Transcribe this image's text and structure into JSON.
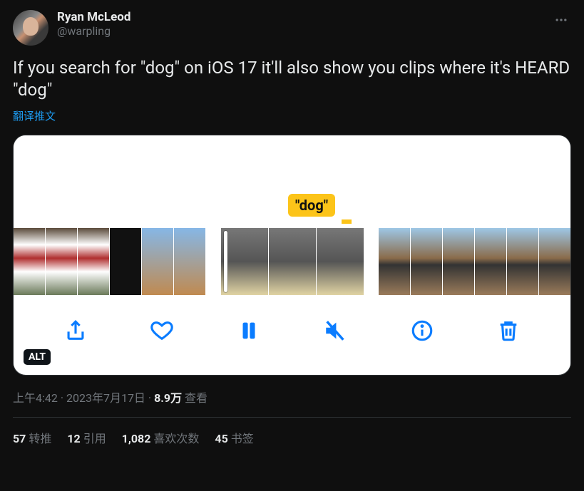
{
  "author": {
    "display_name": "Ryan McLeod",
    "handle": "@warpling"
  },
  "body_text": "If you search for \"dog\" on iOS 17 it'll also show you clips where it's HEARD \"dog\"",
  "translate_label": "翻译推文",
  "media": {
    "search_label": "\"dog\"",
    "alt_badge": "ALT"
  },
  "meta": {
    "time": "上午4:42",
    "sep1": " · ",
    "date": "2023年7月17日",
    "sep2": " · ",
    "views_count": "8.9万",
    "views_label": " 查看"
  },
  "stats": {
    "retweets_count": "57",
    "retweets_label": "转推",
    "quotes_count": "12",
    "quotes_label": "引用",
    "likes_count": "1,082",
    "likes_label": "喜欢次数",
    "bookmarks_count": "45",
    "bookmarks_label": "书签"
  }
}
